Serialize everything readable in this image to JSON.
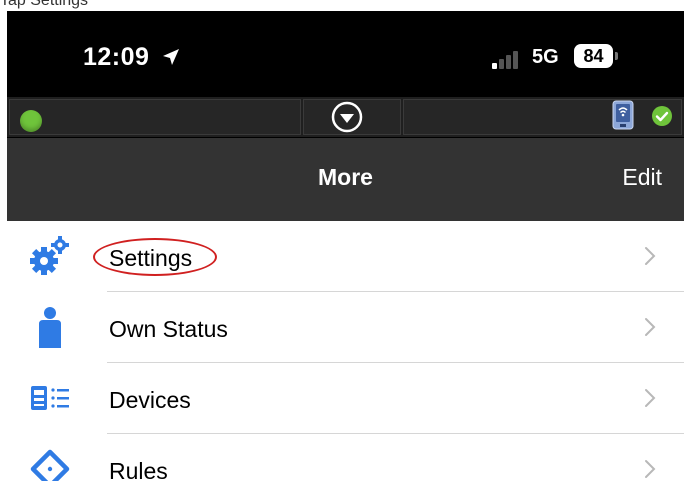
{
  "caption": "Tap Settings",
  "status_bar": {
    "time": "12:09",
    "network": "5G",
    "battery": "84"
  },
  "navbar": {
    "title": "More",
    "edit_label": "Edit"
  },
  "menu": {
    "items": [
      {
        "label": "Settings",
        "icon": "settings-gears-icon",
        "highlighted": true
      },
      {
        "label": "Own Status",
        "icon": "person-icon"
      },
      {
        "label": "Devices",
        "icon": "devices-list-icon"
      },
      {
        "label": "Rules",
        "icon": "rules-diamond-icon"
      }
    ]
  },
  "colors": {
    "accent_blue": "#2f7be4",
    "status_green": "#6fc43b",
    "highlight_red": "#d02020",
    "navbar_bg": "#333333"
  }
}
